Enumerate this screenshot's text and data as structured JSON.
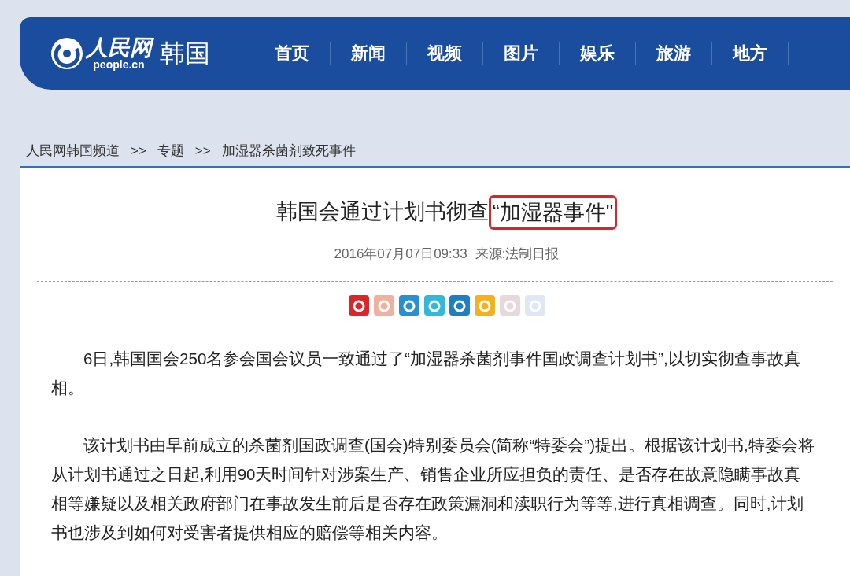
{
  "site": {
    "logo_name": "人民网",
    "logo_domain": "people.cn",
    "channel": "韩国"
  },
  "nav": [
    {
      "label": "首页"
    },
    {
      "label": "新闻"
    },
    {
      "label": "视频"
    },
    {
      "label": "图片"
    },
    {
      "label": "娱乐"
    },
    {
      "label": "旅游"
    },
    {
      "label": "地方"
    }
  ],
  "breadcrumb": [
    "人民网韩国频道",
    ">>",
    "专题",
    ">>",
    "加湿器杀菌剂致死事件"
  ],
  "article": {
    "title": "韩国会通过计划书彻查",
    "title_highlighted": "“加湿器事件\"",
    "published": "2016年07月07日09:33",
    "source": "来源:法制日报",
    "share_icons": [
      {
        "color": "#d9262b"
      },
      {
        "color": "#f0b0a0"
      },
      {
        "color": "#2a8fd0"
      },
      {
        "color": "#33b8d8"
      },
      {
        "color": "#1f7fc0"
      },
      {
        "color": "#f5b020"
      },
      {
        "color": "#e8d8dc"
      },
      {
        "color": "#dfe6f5"
      }
    ],
    "paragraphs": [
      "6日,韩国国会250名参会国会议员一致通过了“加湿器杀菌剂事件国政调查计划书”,以切实彻查事故真相。",
      "该计划书由早前成立的杀菌剂国政调查(国会)特别委员会(简称“特委会”)提出。根据该计划书,特委会将从计划书通过之日起,利用90天时间针对涉案生产、销售企业所应担负的责任、是否存在故意隐瞒事故真相等嫌疑以及相关政府部门在事故发生前后是否存在政策漏洞和渎职行为等等,进行真相调查。同时,计划书也涉及到如何对受害者提供相应的赔偿等相关内容。"
    ]
  }
}
